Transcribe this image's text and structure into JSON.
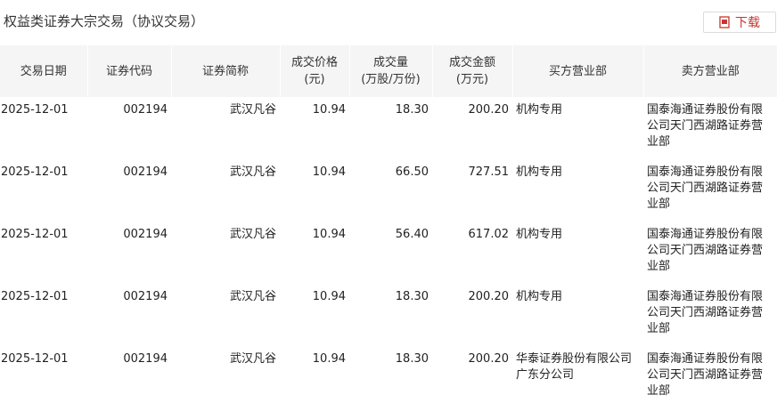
{
  "page": {
    "title": "权益类证券大宗交易（协议交易）",
    "download_label": "下载"
  },
  "columns": [
    {
      "line1": "交易日期",
      "line2": ""
    },
    {
      "line1": "证券代码",
      "line2": ""
    },
    {
      "line1": "证券简称",
      "line2": ""
    },
    {
      "line1": "成交价格",
      "line2": "(元)"
    },
    {
      "line1": "成交量",
      "line2": "(万股/万份)"
    },
    {
      "line1": "成交金额",
      "line2": "(万元)"
    },
    {
      "line1": "买方营业部",
      "line2": ""
    },
    {
      "line1": "卖方营业部",
      "line2": ""
    }
  ],
  "rows": [
    {
      "date": "2025-12-01",
      "code": "002194",
      "name": "武汉凡谷",
      "price": "10.94",
      "volume": "18.30",
      "amount": "200.20",
      "buyer": "机构专用",
      "seller": "国泰海通证券股份有限公司天门西湖路证券营业部"
    },
    {
      "date": "2025-12-01",
      "code": "002194",
      "name": "武汉凡谷",
      "price": "10.94",
      "volume": "66.50",
      "amount": "727.51",
      "buyer": "机构专用",
      "seller": "国泰海通证券股份有限公司天门西湖路证券营业部"
    },
    {
      "date": "2025-12-01",
      "code": "002194",
      "name": "武汉凡谷",
      "price": "10.94",
      "volume": "56.40",
      "amount": "617.02",
      "buyer": "机构专用",
      "seller": "国泰海通证券股份有限公司天门西湖路证券营业部"
    },
    {
      "date": "2025-12-01",
      "code": "002194",
      "name": "武汉凡谷",
      "price": "10.94",
      "volume": "18.30",
      "amount": "200.20",
      "buyer": "机构专用",
      "seller": "国泰海通证券股份有限公司天门西湖路证券营业部"
    },
    {
      "date": "2025-12-01",
      "code": "002194",
      "name": "武汉凡谷",
      "price": "10.94",
      "volume": "18.30",
      "amount": "200.20",
      "buyer": "华泰证券股份有限公司广东分公司",
      "seller": "国泰海通证券股份有限公司天门西湖路证券营业部"
    }
  ],
  "colors": {
    "accent": "#c8352d",
    "header_bg": "#f5f5f5"
  },
  "icons": {
    "download": "document-download-icon"
  }
}
